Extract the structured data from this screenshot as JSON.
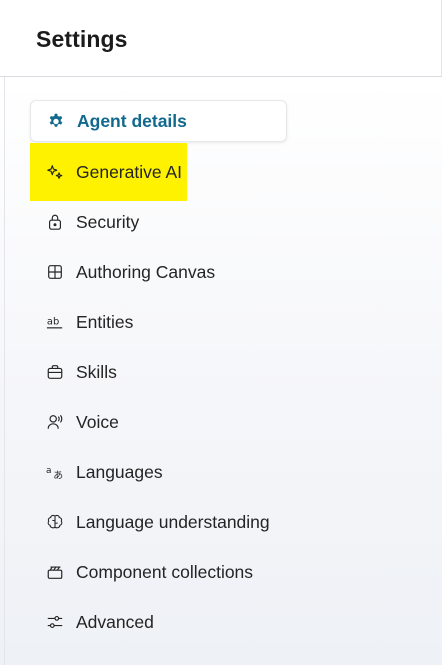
{
  "header": {
    "title": "Settings"
  },
  "colors": {
    "active_text": "#11698e",
    "highlight": "#fff200",
    "text": "#242424"
  },
  "nav": {
    "items": [
      {
        "label": "Agent details",
        "icon": "gear-icon",
        "active": true
      },
      {
        "label": "Generative AI",
        "icon": "sparkle-icon",
        "highlighted": true
      },
      {
        "label": "Security",
        "icon": "lock-icon"
      },
      {
        "label": "Authoring Canvas",
        "icon": "grid-icon"
      },
      {
        "label": "Entities",
        "icon": "ab-text-icon"
      },
      {
        "label": "Skills",
        "icon": "briefcase-icon"
      },
      {
        "label": "Voice",
        "icon": "voice-person-icon"
      },
      {
        "label": "Languages",
        "icon": "translate-icon"
      },
      {
        "label": "Language understanding",
        "icon": "brain-icon"
      },
      {
        "label": "Component collections",
        "icon": "collection-icon"
      },
      {
        "label": "Advanced",
        "icon": "sliders-icon"
      }
    ]
  }
}
